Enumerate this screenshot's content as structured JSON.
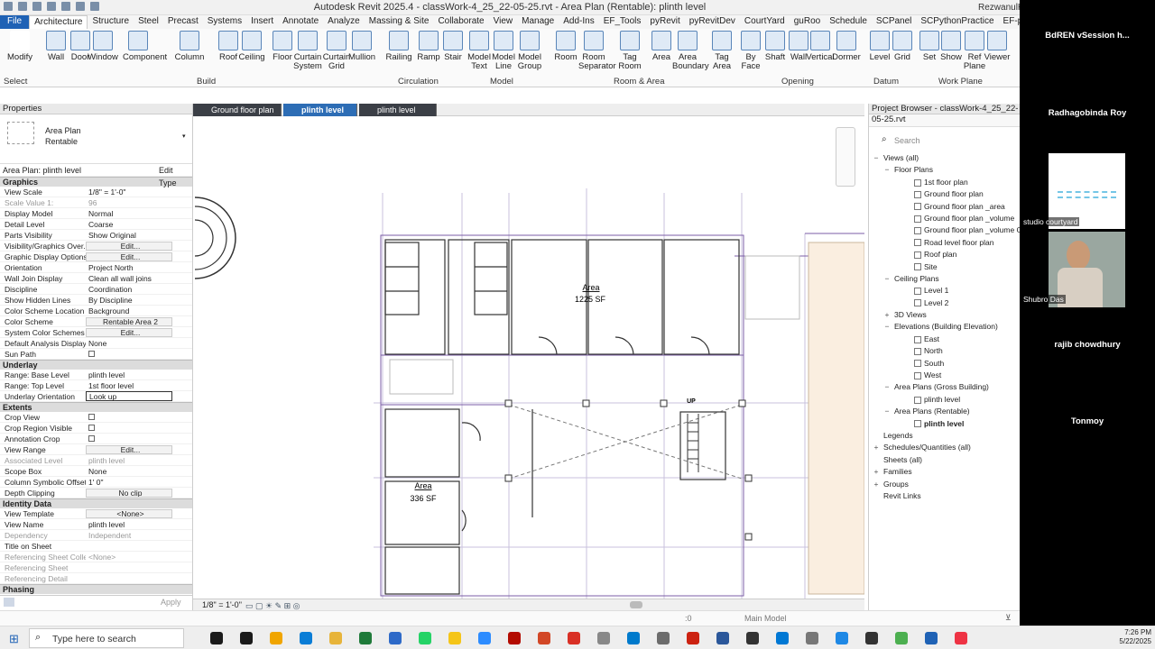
{
  "app": {
    "title": "Autodesk Revit 2025.4 - classWork-4_25_22-05-25.rvt - Area Plan (Rentable): plinth level",
    "user": "RezwanulHoq"
  },
  "menu": [
    "File",
    "Architecture",
    "Structure",
    "Steel",
    "Precast",
    "Systems",
    "Insert",
    "Annotate",
    "Analyze",
    "Massing & Site",
    "Collaborate",
    "View",
    "Manage",
    "Add-Ins",
    "EF_Tools",
    "pyRevit",
    "pyRevitDev",
    "CourtYard",
    "guRoo",
    "Schedule",
    "SCPanel",
    "SCPythonPractice",
    "EF-pyRevitStarterKit_SC"
  ],
  "ribbon": {
    "tools": [
      "Modify",
      "Wall",
      "Door",
      "Window",
      "Component",
      "Column",
      "Roof",
      "Ceiling",
      "Floor",
      "Curtain System",
      "Curtain Grid",
      "Mullion",
      "Railing",
      "Ramp",
      "Stair",
      "Model Text",
      "Model Line",
      "Model Group",
      "Room",
      "Room Separator",
      "Tag Room",
      "Area",
      "Area Boundary",
      "Tag Area",
      "By Face",
      "Shaft",
      "Wall",
      "Vertical",
      "Dormer",
      "Level",
      "Grid",
      "Set",
      "Show",
      "Ref Plane",
      "Viewer"
    ],
    "groups": [
      "Select",
      "Build",
      "Circulation",
      "Model",
      "Room & Area",
      "Opening",
      "Datum",
      "Work Plane"
    ]
  },
  "properties": {
    "header": "Properties",
    "type_name": "Area Plan",
    "type_sub": "Rentable",
    "instance": "Area Plan: plinth level",
    "edit_type": "Edit Type",
    "sections": [
      {
        "title": "Graphics",
        "rows": [
          [
            "View Scale",
            "1/8\" = 1'-0\"",
            ""
          ],
          [
            "Scale Value    1:",
            "96",
            "dis"
          ],
          [
            "Display Model",
            "Normal",
            ""
          ],
          [
            "Detail Level",
            "Coarse",
            ""
          ],
          [
            "Parts Visibility",
            "Show Original",
            ""
          ],
          [
            "Visibility/Graphics Over...",
            "Edit...",
            "btn"
          ],
          [
            "Graphic Display Options",
            "Edit...",
            "btn"
          ],
          [
            "Orientation",
            "Project North",
            ""
          ],
          [
            "Wall Join Display",
            "Clean all wall joins",
            ""
          ],
          [
            "Discipline",
            "Coordination",
            ""
          ],
          [
            "Show Hidden Lines",
            "By Discipline",
            ""
          ],
          [
            "Color Scheme Location",
            "Background",
            ""
          ],
          [
            "Color Scheme",
            "Rentable Area 2",
            "btn"
          ],
          [
            "System Color Schemes",
            "Edit...",
            "btn"
          ],
          [
            "Default Analysis Display...",
            "None",
            ""
          ],
          [
            "Sun Path",
            "",
            "chk"
          ]
        ]
      },
      {
        "title": "Underlay",
        "rows": [
          [
            "Range: Base Level",
            "plinth level",
            ""
          ],
          [
            "Range: Top Level",
            "1st floor level",
            ""
          ],
          [
            "Underlay Orientation",
            "Look up",
            "box"
          ]
        ]
      },
      {
        "title": "Extents",
        "rows": [
          [
            "Crop View",
            "",
            "chk"
          ],
          [
            "Crop Region Visible",
            "",
            "chk"
          ],
          [
            "Annotation Crop",
            "",
            "chk"
          ],
          [
            "View Range",
            "Edit...",
            "btn"
          ],
          [
            "Associated Level",
            "plinth level",
            "dis"
          ],
          [
            "Scope Box",
            "None",
            ""
          ],
          [
            "Column Symbolic Offset",
            "1'  0\"",
            ""
          ],
          [
            "Depth Clipping",
            "No clip",
            "btn"
          ]
        ]
      },
      {
        "title": "Identity Data",
        "rows": [
          [
            "View Template",
            "<None>",
            "btn"
          ],
          [
            "View Name",
            "plinth level",
            ""
          ],
          [
            "Dependency",
            "Independent",
            "dis"
          ],
          [
            "Title on Sheet",
            "",
            ""
          ],
          [
            "Referencing Sheet Colle...",
            "<None>",
            "dis"
          ],
          [
            "Referencing Sheet",
            "",
            "dis"
          ],
          [
            "Referencing Detail",
            "",
            "dis"
          ]
        ]
      },
      {
        "title": "Phasing",
        "rows": []
      }
    ],
    "apply": "Apply"
  },
  "tabs": [
    "Ground floor plan",
    "plinth level",
    "plinth level"
  ],
  "canvas": {
    "area1": {
      "name": "Area",
      "value": "1225 SF"
    },
    "area2": {
      "name": "Area",
      "value": "336 SF"
    },
    "up": "UP"
  },
  "statusbar": {
    "scale": "1/8\" = 1'-0\""
  },
  "bottom": {
    "model": "Main Model",
    "zero": ":0"
  },
  "project_browser": {
    "header": "Project Browser - classWork-4_25_22-05-25.rvt",
    "search": "Search",
    "tree": [
      {
        "t": "Views (all)",
        "l": 0,
        "e": "−"
      },
      {
        "t": "Floor Plans",
        "l": 1,
        "e": "−"
      },
      {
        "t": "1st floor plan",
        "l": 2,
        "e": ""
      },
      {
        "t": "Ground floor plan",
        "l": 2,
        "e": ""
      },
      {
        "t": "Ground floor plan _area",
        "l": 2,
        "e": ""
      },
      {
        "t": "Ground floor plan _volume",
        "l": 2,
        "e": ""
      },
      {
        "t": "Ground floor plan _volume Copy",
        "l": 2,
        "e": ""
      },
      {
        "t": "Road level floor plan",
        "l": 2,
        "e": ""
      },
      {
        "t": "Roof plan",
        "l": 2,
        "e": ""
      },
      {
        "t": "Site",
        "l": 2,
        "e": ""
      },
      {
        "t": "Ceiling Plans",
        "l": 1,
        "e": "−"
      },
      {
        "t": "Level 1",
        "l": 2,
        "e": ""
      },
      {
        "t": "Level 2",
        "l": 2,
        "e": ""
      },
      {
        "t": "3D Views",
        "l": 1,
        "e": "+"
      },
      {
        "t": "Elevations (Building Elevation)",
        "l": 1,
        "e": "−"
      },
      {
        "t": "East",
        "l": 2,
        "e": ""
      },
      {
        "t": "North",
        "l": 2,
        "e": ""
      },
      {
        "t": "South",
        "l": 2,
        "e": ""
      },
      {
        "t": "West",
        "l": 2,
        "e": ""
      },
      {
        "t": "Area Plans (Gross Building)",
        "l": 1,
        "e": "−"
      },
      {
        "t": "plinth level",
        "l": 2,
        "e": ""
      },
      {
        "t": "Area Plans (Rentable)",
        "l": 1,
        "e": "−"
      },
      {
        "t": "plinth level",
        "l": 2,
        "e": "",
        "b": true
      },
      {
        "t": "Legends",
        "l": 0,
        "e": ""
      },
      {
        "t": "Schedules/Quantities (all)",
        "l": 0,
        "e": "+"
      },
      {
        "t": "Sheets (all)",
        "l": 0,
        "e": ""
      },
      {
        "t": "Families",
        "l": 0,
        "e": "+"
      },
      {
        "t": "Groups",
        "l": 0,
        "e": "+"
      },
      {
        "t": "Revit Links",
        "l": 0,
        "e": ""
      }
    ]
  },
  "participants": [
    "BdREN vSession h...",
    "Radhagobinda Roy",
    "studio courtyard",
    "Shubro Das",
    "rajib chowdhury",
    "Tonmoy"
  ],
  "taskbar": {
    "search": "Type here to search",
    "time": "7:26 PM",
    "date": "5/22/2025"
  },
  "colors": {
    "file_blue": "#1f62b5",
    "tab_active": "#2d6db5",
    "area_line": "#7b5ea7",
    "video_bg": "#000000"
  }
}
